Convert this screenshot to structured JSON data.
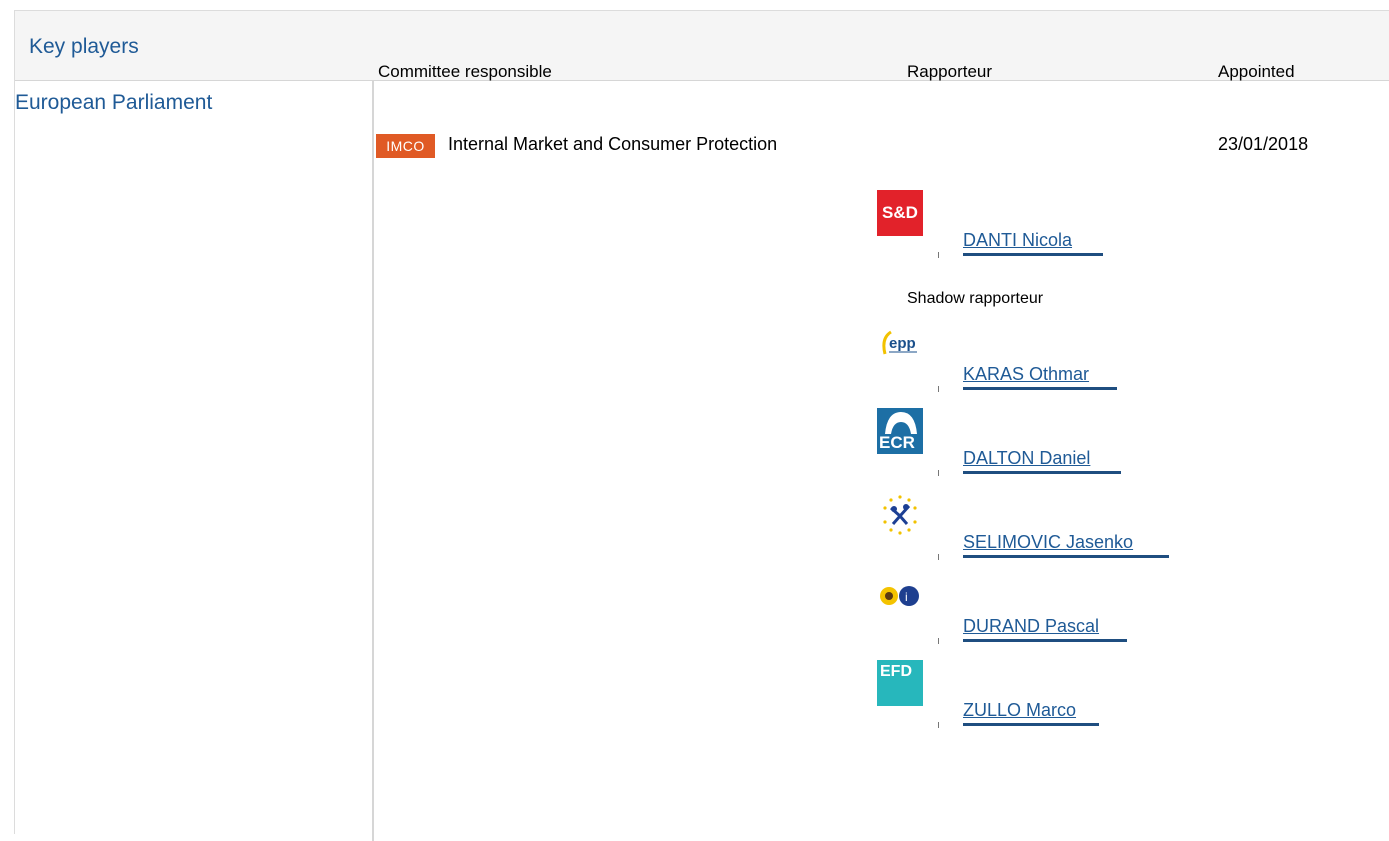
{
  "section": {
    "title": "Key players"
  },
  "institution": "European Parliament",
  "columns": {
    "committee": "Committee responsible",
    "rapporteur": "Rapporteur",
    "appointed": "Appointed"
  },
  "committee": {
    "code": "IMCO",
    "name": "Internal Market and Consumer Protection",
    "appointed": "23/01/2018",
    "badge_color": "#e05a25"
  },
  "rapporteur": {
    "name": "DANTI Nicola",
    "group_logo": "S&D"
  },
  "shadow_label": "Shadow rapporteur",
  "shadow_rapporteurs": [
    {
      "name": "KARAS Othmar",
      "group_logo": "epp"
    },
    {
      "name": "DALTON Daniel",
      "group_logo": "ECR"
    },
    {
      "name": "SELIMOVIC Jasenko",
      "group_logo": "renew-stars-icon"
    },
    {
      "name": "DURAND Pascal",
      "group_logo": "greens-efa-icon"
    },
    {
      "name": "ZULLO Marco",
      "group_logo": "EFD"
    }
  ]
}
